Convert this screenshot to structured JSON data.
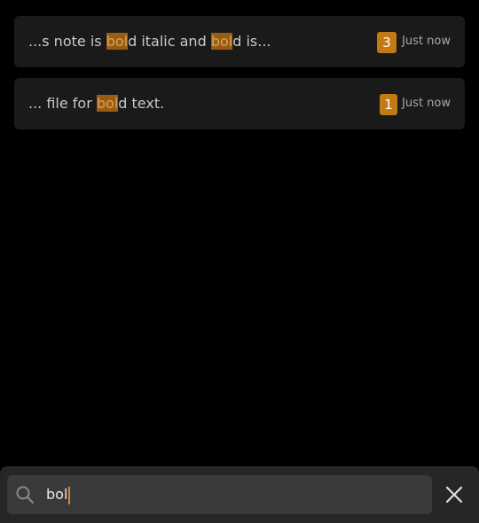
{
  "results": [
    {
      "parts": [
        {
          "text": "...s note is ",
          "hl": false
        },
        {
          "text": "bol",
          "hl": true
        },
        {
          "text": "d italic and ",
          "hl": false
        },
        {
          "text": "bol",
          "hl": true
        },
        {
          "text": "d is...",
          "hl": false
        }
      ],
      "count": "3",
      "time": "Just now"
    },
    {
      "parts": [
        {
          "text": "... file for ",
          "hl": false
        },
        {
          "text": "bol",
          "hl": true
        },
        {
          "text": "d text.",
          "hl": false
        }
      ],
      "count": "1",
      "time": "Just now"
    }
  ],
  "search": {
    "value": "bol",
    "icon": "search-icon"
  },
  "close": {
    "icon": "close-icon"
  },
  "colors": {
    "highlight_bg": "#9a5c10",
    "badge_bg": "#c17a14",
    "caret": "#d9892a"
  }
}
